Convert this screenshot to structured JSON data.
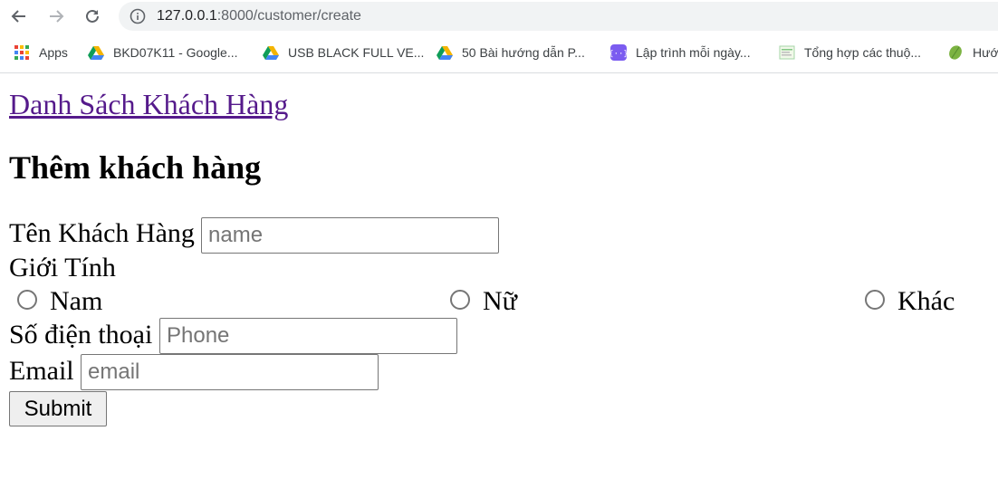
{
  "browser": {
    "url_host": "127.0.0.1",
    "url_path": ":8000/customer/create",
    "bookmarks": [
      {
        "label": "Apps",
        "icon": "apps-grid-icon"
      },
      {
        "label": "BKD07K11 - Google...",
        "icon": "google-drive-icon"
      },
      {
        "label": "USB BLACK FULL VE...",
        "icon": "google-drive-icon"
      },
      {
        "label": "50 Bài hướng dẫn P...",
        "icon": "google-drive-icon"
      },
      {
        "label": "Lập trình mỗi ngày...",
        "icon": "code-bracket-icon"
      },
      {
        "label": "Tổng hợp các thuộ...",
        "icon": "doc-thumbnail-icon"
      },
      {
        "label": "Hướ",
        "icon": "leaf-icon"
      }
    ]
  },
  "page": {
    "back_link": "Danh Sách Khách Hàng",
    "title": "Thêm khách hàng",
    "form": {
      "name_label": "Tên Khách Hàng",
      "name_placeholder": "name",
      "gender_label": "Giới Tính",
      "gender_options": [
        "Nam",
        "Nữ",
        "Khác"
      ],
      "phone_label": "Số điện thoại",
      "phone_placeholder": "Phone",
      "email_label": "Email",
      "email_placeholder": "email",
      "submit_label": "Submit"
    }
  },
  "colors": {
    "link_visited": "#551a8b",
    "omnibox_bg": "#f1f3f4",
    "drive_green": "#0f9d58",
    "drive_blue": "#4285f4",
    "drive_yellow": "#f4b400"
  }
}
